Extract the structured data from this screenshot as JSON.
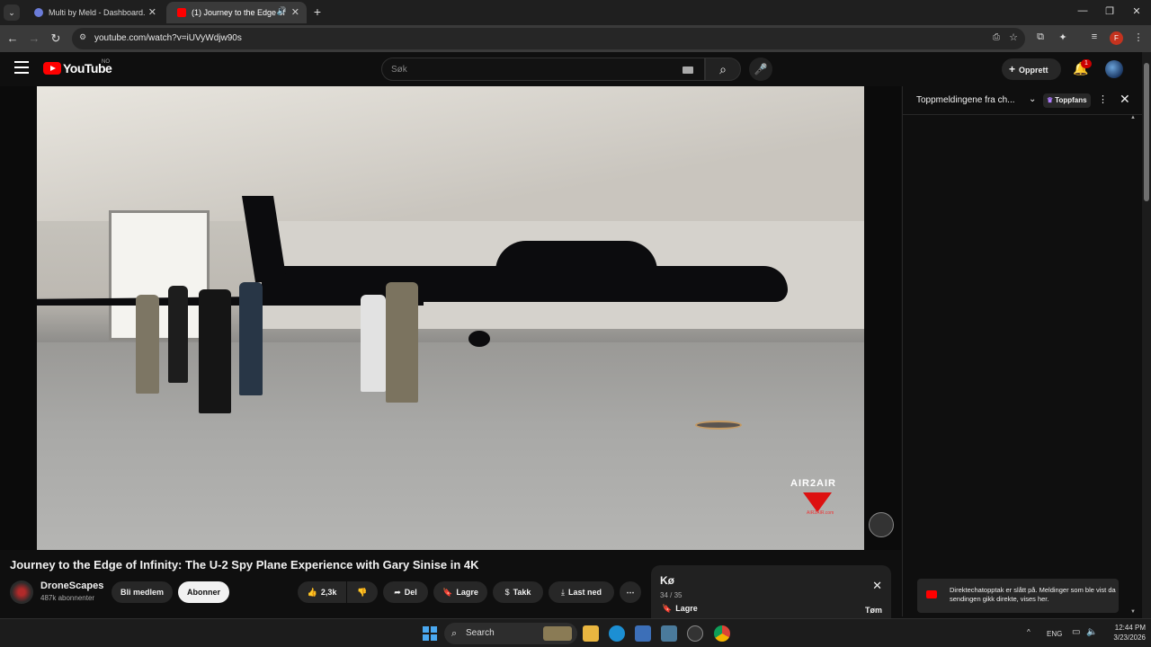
{
  "browser": {
    "tabs": [
      {
        "label": "Multi by Meld - Dashboard.",
        "active": false
      },
      {
        "label": "(1) Journey to the Edge of I",
        "active": true
      }
    ],
    "url": "youtube.com/watch?v=iUVyWdjw90s",
    "profile_initial": "F"
  },
  "youtube": {
    "logo_text": "YouTube",
    "country_code": "NO",
    "search_placeholder": "Søk",
    "create_label": "Opprett",
    "notification_count": "1"
  },
  "video": {
    "title": "Journey to the Edge of Infinity: The U-2 Spy Plane Experience with Gary Sinise in 4K",
    "watermark": "AIR2AIR",
    "watermark_sub": "AIR2AIR.com",
    "channel": {
      "name": "DroneScapes",
      "subscribers": "487k abonnenter"
    },
    "actions": {
      "member_label": "Bli medlem",
      "subscribe_label": "Abonner",
      "like_count": "2,3k",
      "share_label": "Del",
      "save_label": "Lagre",
      "thanks_label": "Takk",
      "download_label": "Last ned"
    }
  },
  "queue": {
    "title": "Kø",
    "position": "34 / 35",
    "save_label": "Lagre",
    "clear_label": "Tøm"
  },
  "chat": {
    "title": "Toppmeldingene fra ch...",
    "badge": "Toppfans",
    "notice": "Direktechatopptak er slått på. Meldinger som ble vist da sendingen gikk direkte, vises her."
  },
  "taskbar": {
    "search_label": "Search",
    "language": "ENG",
    "time": "12:44 PM",
    "date": "3/23/2026"
  },
  "colors": {
    "brand_red": "#ff0000",
    "background": "#0f0f0f",
    "pill": "#272727"
  }
}
